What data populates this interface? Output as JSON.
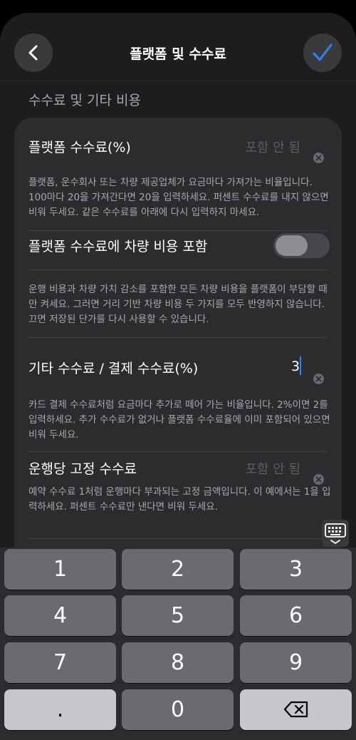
{
  "header": {
    "title": "플랫폼 및 수수료",
    "back_icon": "chevron-left-icon",
    "done_icon": "checkmark-icon",
    "accent": "#2d83f5"
  },
  "section": {
    "title": "수수료 및 기타 비용"
  },
  "rows": [
    {
      "label": "플랫폼 수수료(%)",
      "placeholder": "포함 안 됨",
      "description": "플랫폼, 운수회사 또는 차량 제공업체가 요금마다 가져가는 비율입니다. 100마다 20을 가져간다면 20을 입력하세요. 퍼센트 수수료를 내지 않으면 비워 두세요. 같은 수수료를 아래에 다시 입력하지 마세요."
    },
    {
      "label": "플랫폼 수수료에 차량 비용 포함",
      "toggle_on": false,
      "description": "운행 비용과 차량 가치 감소를 포함한 모든 차량 비용을 플랫폼이 부담할 때만 켜세요. 그러면 거리 기반 차량 비용 두 가지를 모두 반영하지 않습니다. 끄면 저장된 단가를 다시 사용할 수 있습니다."
    },
    {
      "label": "기타 수수료 / 결제 수수료(%)",
      "value": "3",
      "description": "카드 결제 수수료처럼 요금마다 추가로 떼어 가는 비율입니다. 2%이면 2를 입력하세요. 추가 수수료가 없거나 플랫폼 수수료율에 이미 포함되어 있으면 비워 두세요."
    },
    {
      "label": "운행당 고정 수수료",
      "placeholder": "포함 안 됨",
      "description": "예약 수수료 1처럼 운행마다 부과되는 고정 금액입니다. 이 예에서는 1을 입력하세요. 퍼센트 수수료만 낸다면 비워 두세요."
    }
  ],
  "keyboard": {
    "toggle_icon": "keyboard-dismiss-icon",
    "keys": [
      "1",
      "2",
      "3",
      "4",
      "5",
      "6",
      "7",
      "8",
      "9",
      ".",
      "0"
    ],
    "delete_icon": "backspace-icon"
  }
}
